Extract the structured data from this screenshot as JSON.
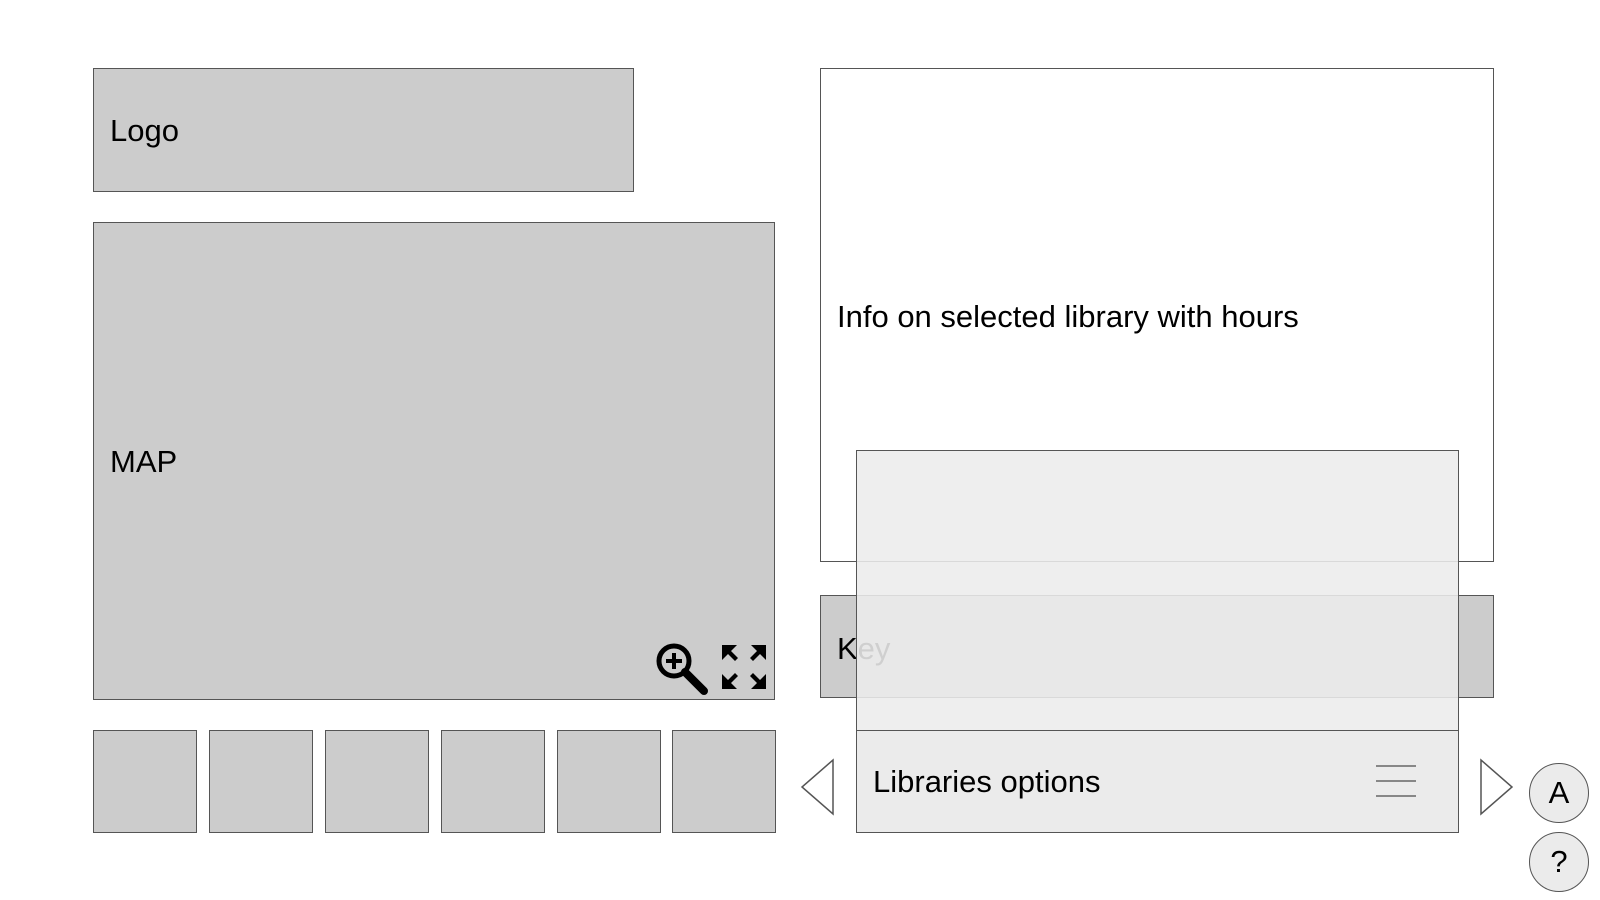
{
  "logo": {
    "label": "Logo"
  },
  "map": {
    "label": "MAP",
    "zoom_icon": "zoom-in-icon",
    "fullscreen_icon": "fullscreen-icon"
  },
  "thumbnails": [
    {
      "label": ""
    },
    {
      "label": ""
    },
    {
      "label": ""
    },
    {
      "label": ""
    },
    {
      "label": ""
    },
    {
      "label": ""
    }
  ],
  "info_panel": {
    "label": "Info on selected library with hours"
  },
  "key": {
    "label": "Key"
  },
  "libraries_bar": {
    "label": "Libraries options",
    "menu_icon": "hamburger-menu-icon",
    "prev_icon": "chevron-left-icon",
    "next_icon": "chevron-right-icon"
  },
  "buttons": {
    "a_label": "A",
    "help_label": "?"
  },
  "colors": {
    "placeholder_fill": "#cccccc",
    "overlay_fill": "#ebebeb",
    "border": "#555555"
  }
}
